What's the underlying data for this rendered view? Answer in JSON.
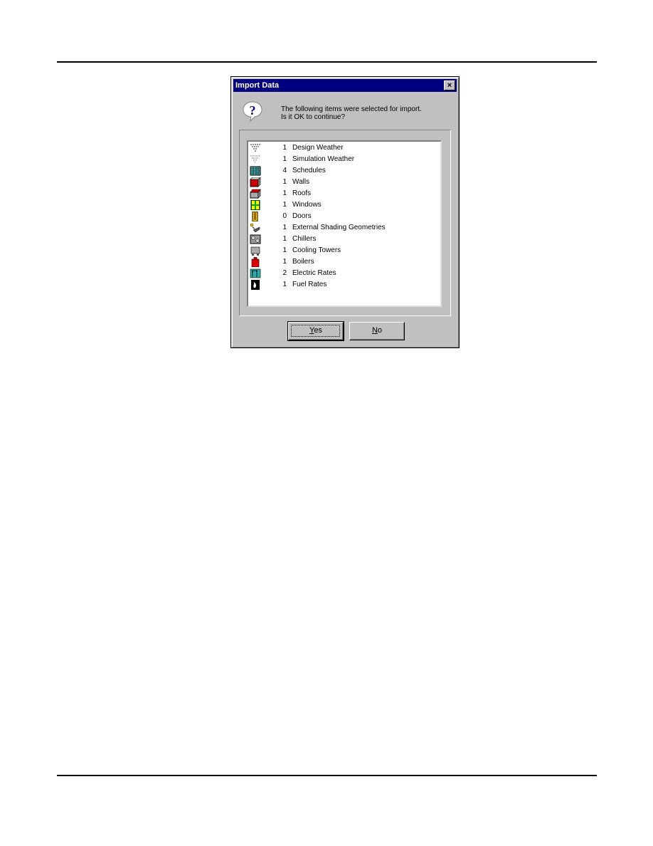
{
  "dialog": {
    "title": "Import Data",
    "close_label": "×",
    "message_line1": "The following items were selected for import.",
    "message_line2": "Is it OK to continue?",
    "question_icon": "question-icon",
    "items": [
      {
        "count": "1",
        "label": "Design Weather",
        "icon": "design-weather-icon"
      },
      {
        "count": "1",
        "label": "Simulation Weather",
        "icon": "simulation-weather-icon"
      },
      {
        "count": "4",
        "label": "Schedules",
        "icon": "schedules-icon"
      },
      {
        "count": "1",
        "label": "Walls",
        "icon": "walls-icon"
      },
      {
        "count": "1",
        "label": "Roofs",
        "icon": "roofs-icon"
      },
      {
        "count": "1",
        "label": "Windows",
        "icon": "windows-icon"
      },
      {
        "count": "0",
        "label": "Doors",
        "icon": "doors-icon"
      },
      {
        "count": "1",
        "label": "External Shading Geometries",
        "icon": "shading-icon"
      },
      {
        "count": "1",
        "label": "Chillers",
        "icon": "chillers-icon"
      },
      {
        "count": "1",
        "label": "Cooling Towers",
        "icon": "cooling-towers-icon"
      },
      {
        "count": "1",
        "label": "Boilers",
        "icon": "boilers-icon"
      },
      {
        "count": "2",
        "label": "Electric Rates",
        "icon": "electric-rates-icon"
      },
      {
        "count": "1",
        "label": "Fuel Rates",
        "icon": "fuel-rates-icon"
      }
    ],
    "yes_mnemonic": "Y",
    "yes_rest": "es",
    "no_mnemonic": "N",
    "no_rest": "o"
  }
}
